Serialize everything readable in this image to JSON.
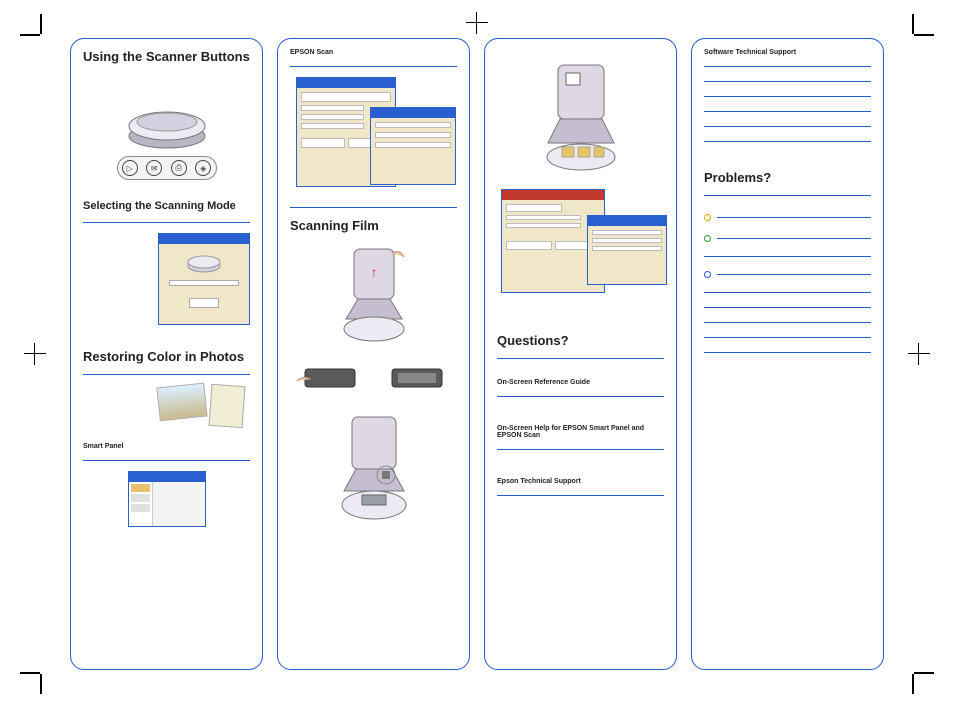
{
  "panel1": {
    "title": "Using the Scanner Buttons",
    "selecting_mode": "Selecting the Scanning Mode",
    "restoring": "Restoring Color in Photos",
    "smart_panel": "Smart Panel"
  },
  "panel2": {
    "epson_scan": "EPSON Scan",
    "scanning_film": "Scanning Film"
  },
  "panel3": {
    "questions": "Questions?",
    "ref_guide": "On-Screen Reference Guide",
    "onscreen_help": "On-Screen Help for EPSON Smart Panel and EPSON Scan",
    "tech_support": "Epson Technical Support"
  },
  "panel4": {
    "software_support": "Software Technical Support",
    "problems": "Problems?"
  },
  "icons": {
    "start": "▷",
    "mail": "✉",
    "print": "⎙",
    "scan": "◈"
  }
}
